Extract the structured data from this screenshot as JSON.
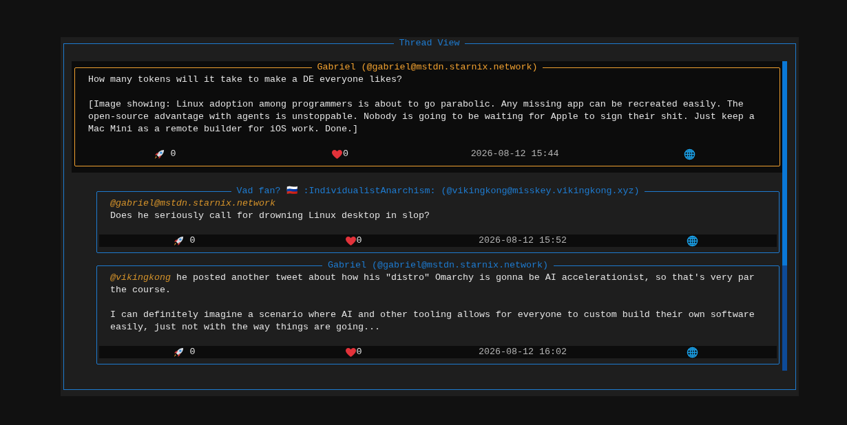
{
  "panel": {
    "title": "Thread View"
  },
  "posts": [
    {
      "kind": "root",
      "selected": true,
      "title": "Gabriel (@gabriel@mstdn.starnix.network)",
      "paragraphs": [
        [
          {
            "kind": "text",
            "text": "How many tokens will it take to make a DE everyone likes?"
          }
        ],
        [
          {
            "kind": "text",
            "text": "[Image showing: Linux adoption among programmers is about to go parabolic. Any missing app can be recreated easily. The open-source advantage with agents is unstoppable. Nobody is going to be waiting for Apple to sign their shit. Just keep a Mac Mini as a remote builder for iOS work. Done.]"
          }
        ]
      ],
      "boosts": "0",
      "likes": "0",
      "date": "2026-08-12 15:44"
    },
    {
      "kind": "reply",
      "selected": false,
      "title": "Vad fan? 🇷🇺 :IndividualistAnarchism: (@vikingkong@misskey.vikingkong.xyz)",
      "reply_to": "@gabriel@mstdn.starnix.network",
      "paragraphs": [
        [
          {
            "kind": "text",
            "text": "Does he seriously call for drowning Linux desktop in slop?"
          }
        ]
      ],
      "boosts": "0",
      "likes": "0",
      "date": "2026-08-12 15:52"
    },
    {
      "kind": "reply",
      "selected": false,
      "title": "Gabriel (@gabriel@mstdn.starnix.network)",
      "paragraphs": [
        [
          {
            "kind": "mention",
            "text": "@vikingkong"
          },
          {
            "kind": "text",
            "text": " he posted another tweet about how his \"distro\" Omarchy is gonna be AI accelerationist, so that's very par the course."
          }
        ],
        [
          {
            "kind": "text",
            "text": "I can definitely imagine a scenario where AI and other tooling allows for everyone to custom build their own software easily, just not with the way things are going..."
          }
        ]
      ],
      "boosts": "0",
      "likes": "0",
      "date": "2026-08-12 16:02"
    }
  ]
}
